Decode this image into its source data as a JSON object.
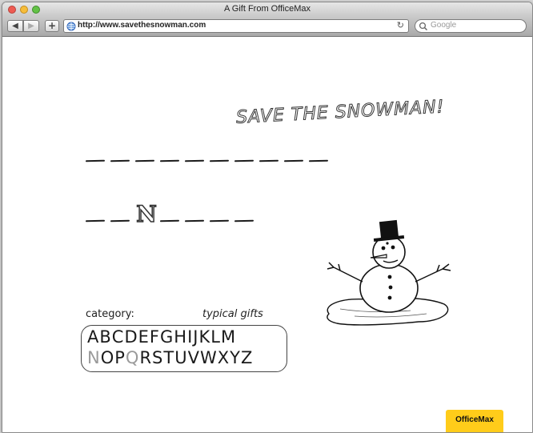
{
  "window": {
    "title": "A Gift From OfficeMax"
  },
  "toolbar": {
    "url": "http://www.savethesnowman.com",
    "search_placeholder": "Google"
  },
  "game": {
    "title": "SAVE THE SNOWMAN!",
    "word1": [
      "",
      "",
      "",
      "",
      "",
      "",
      "",
      "",
      "",
      ""
    ],
    "word2": [
      "",
      "",
      "N",
      "",
      "",
      "",
      ""
    ],
    "category_label": "category:",
    "category_value": "typical gifts",
    "alphabet_row1": [
      "A",
      "B",
      "C",
      "D",
      "E",
      "F",
      "G",
      "H",
      "I",
      "J",
      "K",
      "L",
      "M"
    ],
    "alphabet_row2": [
      "N",
      "O",
      "P",
      "Q",
      "R",
      "S",
      "T",
      "U",
      "V",
      "W",
      "X",
      "Y",
      "Z"
    ],
    "used_letters": [
      "N",
      "Q"
    ]
  },
  "footer": {
    "logo": "OfficeMax"
  },
  "colors": {
    "accent": "#ffcc1a",
    "ink": "#1b1b1b",
    "used": "#9a9a9a"
  }
}
